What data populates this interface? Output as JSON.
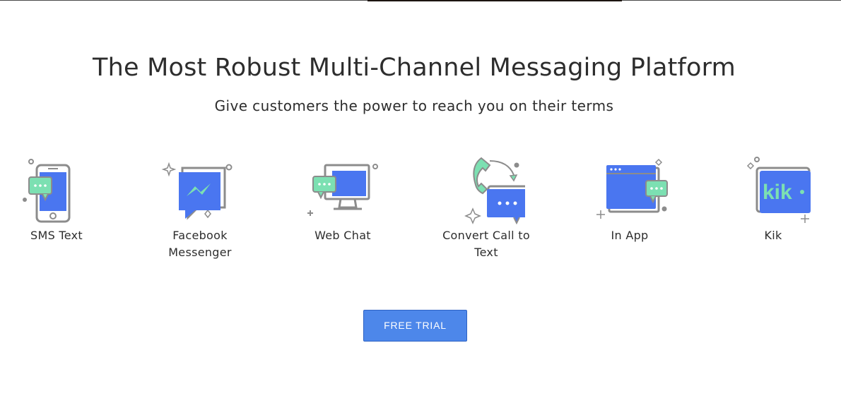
{
  "heading": "The Most Robust Multi-Channel Messaging Platform",
  "subheading": "Give customers the power to reach you on their terms",
  "colors": {
    "accent_blue": "#4a76f0",
    "accent_mint": "#7ce0b2",
    "outline_gray": "#8c8c8c",
    "button_blue": "#4d87ea"
  },
  "channels": [
    {
      "label": "SMS Text",
      "icon": "sms-phone-icon"
    },
    {
      "label": "Facebook Messenger",
      "icon": "facebook-messenger-icon"
    },
    {
      "label": "Web Chat",
      "icon": "web-chat-monitor-icon"
    },
    {
      "label": "Convert Call to Text",
      "icon": "call-to-text-icon"
    },
    {
      "label": "In App",
      "icon": "in-app-window-icon"
    },
    {
      "label": "Kik",
      "icon": "kik-logo-icon"
    }
  ],
  "kik_logo_text": "kik",
  "cta": {
    "label": "FREE TRIAL"
  }
}
